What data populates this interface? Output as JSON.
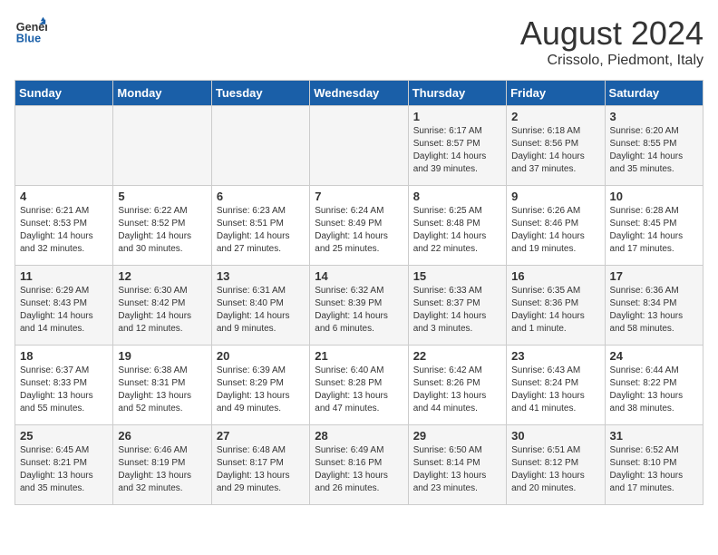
{
  "logo": {
    "line1": "General",
    "line2": "Blue"
  },
  "title": "August 2024",
  "subtitle": "Crissolo, Piedmont, Italy",
  "weekdays": [
    "Sunday",
    "Monday",
    "Tuesday",
    "Wednesday",
    "Thursday",
    "Friday",
    "Saturday"
  ],
  "weeks": [
    [
      {
        "day": "",
        "info": ""
      },
      {
        "day": "",
        "info": ""
      },
      {
        "day": "",
        "info": ""
      },
      {
        "day": "",
        "info": ""
      },
      {
        "day": "1",
        "info": "Sunrise: 6:17 AM\nSunset: 8:57 PM\nDaylight: 14 hours\nand 39 minutes."
      },
      {
        "day": "2",
        "info": "Sunrise: 6:18 AM\nSunset: 8:56 PM\nDaylight: 14 hours\nand 37 minutes."
      },
      {
        "day": "3",
        "info": "Sunrise: 6:20 AM\nSunset: 8:55 PM\nDaylight: 14 hours\nand 35 minutes."
      }
    ],
    [
      {
        "day": "4",
        "info": "Sunrise: 6:21 AM\nSunset: 8:53 PM\nDaylight: 14 hours\nand 32 minutes."
      },
      {
        "day": "5",
        "info": "Sunrise: 6:22 AM\nSunset: 8:52 PM\nDaylight: 14 hours\nand 30 minutes."
      },
      {
        "day": "6",
        "info": "Sunrise: 6:23 AM\nSunset: 8:51 PM\nDaylight: 14 hours\nand 27 minutes."
      },
      {
        "day": "7",
        "info": "Sunrise: 6:24 AM\nSunset: 8:49 PM\nDaylight: 14 hours\nand 25 minutes."
      },
      {
        "day": "8",
        "info": "Sunrise: 6:25 AM\nSunset: 8:48 PM\nDaylight: 14 hours\nand 22 minutes."
      },
      {
        "day": "9",
        "info": "Sunrise: 6:26 AM\nSunset: 8:46 PM\nDaylight: 14 hours\nand 19 minutes."
      },
      {
        "day": "10",
        "info": "Sunrise: 6:28 AM\nSunset: 8:45 PM\nDaylight: 14 hours\nand 17 minutes."
      }
    ],
    [
      {
        "day": "11",
        "info": "Sunrise: 6:29 AM\nSunset: 8:43 PM\nDaylight: 14 hours\nand 14 minutes."
      },
      {
        "day": "12",
        "info": "Sunrise: 6:30 AM\nSunset: 8:42 PM\nDaylight: 14 hours\nand 12 minutes."
      },
      {
        "day": "13",
        "info": "Sunrise: 6:31 AM\nSunset: 8:40 PM\nDaylight: 14 hours\nand 9 minutes."
      },
      {
        "day": "14",
        "info": "Sunrise: 6:32 AM\nSunset: 8:39 PM\nDaylight: 14 hours\nand 6 minutes."
      },
      {
        "day": "15",
        "info": "Sunrise: 6:33 AM\nSunset: 8:37 PM\nDaylight: 14 hours\nand 3 minutes."
      },
      {
        "day": "16",
        "info": "Sunrise: 6:35 AM\nSunset: 8:36 PM\nDaylight: 14 hours\nand 1 minute."
      },
      {
        "day": "17",
        "info": "Sunrise: 6:36 AM\nSunset: 8:34 PM\nDaylight: 13 hours\nand 58 minutes."
      }
    ],
    [
      {
        "day": "18",
        "info": "Sunrise: 6:37 AM\nSunset: 8:33 PM\nDaylight: 13 hours\nand 55 minutes."
      },
      {
        "day": "19",
        "info": "Sunrise: 6:38 AM\nSunset: 8:31 PM\nDaylight: 13 hours\nand 52 minutes."
      },
      {
        "day": "20",
        "info": "Sunrise: 6:39 AM\nSunset: 8:29 PM\nDaylight: 13 hours\nand 49 minutes."
      },
      {
        "day": "21",
        "info": "Sunrise: 6:40 AM\nSunset: 8:28 PM\nDaylight: 13 hours\nand 47 minutes."
      },
      {
        "day": "22",
        "info": "Sunrise: 6:42 AM\nSunset: 8:26 PM\nDaylight: 13 hours\nand 44 minutes."
      },
      {
        "day": "23",
        "info": "Sunrise: 6:43 AM\nSunset: 8:24 PM\nDaylight: 13 hours\nand 41 minutes."
      },
      {
        "day": "24",
        "info": "Sunrise: 6:44 AM\nSunset: 8:22 PM\nDaylight: 13 hours\nand 38 minutes."
      }
    ],
    [
      {
        "day": "25",
        "info": "Sunrise: 6:45 AM\nSunset: 8:21 PM\nDaylight: 13 hours\nand 35 minutes."
      },
      {
        "day": "26",
        "info": "Sunrise: 6:46 AM\nSunset: 8:19 PM\nDaylight: 13 hours\nand 32 minutes."
      },
      {
        "day": "27",
        "info": "Sunrise: 6:48 AM\nSunset: 8:17 PM\nDaylight: 13 hours\nand 29 minutes."
      },
      {
        "day": "28",
        "info": "Sunrise: 6:49 AM\nSunset: 8:16 PM\nDaylight: 13 hours\nand 26 minutes."
      },
      {
        "day": "29",
        "info": "Sunrise: 6:50 AM\nSunset: 8:14 PM\nDaylight: 13 hours\nand 23 minutes."
      },
      {
        "day": "30",
        "info": "Sunrise: 6:51 AM\nSunset: 8:12 PM\nDaylight: 13 hours\nand 20 minutes."
      },
      {
        "day": "31",
        "info": "Sunrise: 6:52 AM\nSunset: 8:10 PM\nDaylight: 13 hours\nand 17 minutes."
      }
    ]
  ]
}
